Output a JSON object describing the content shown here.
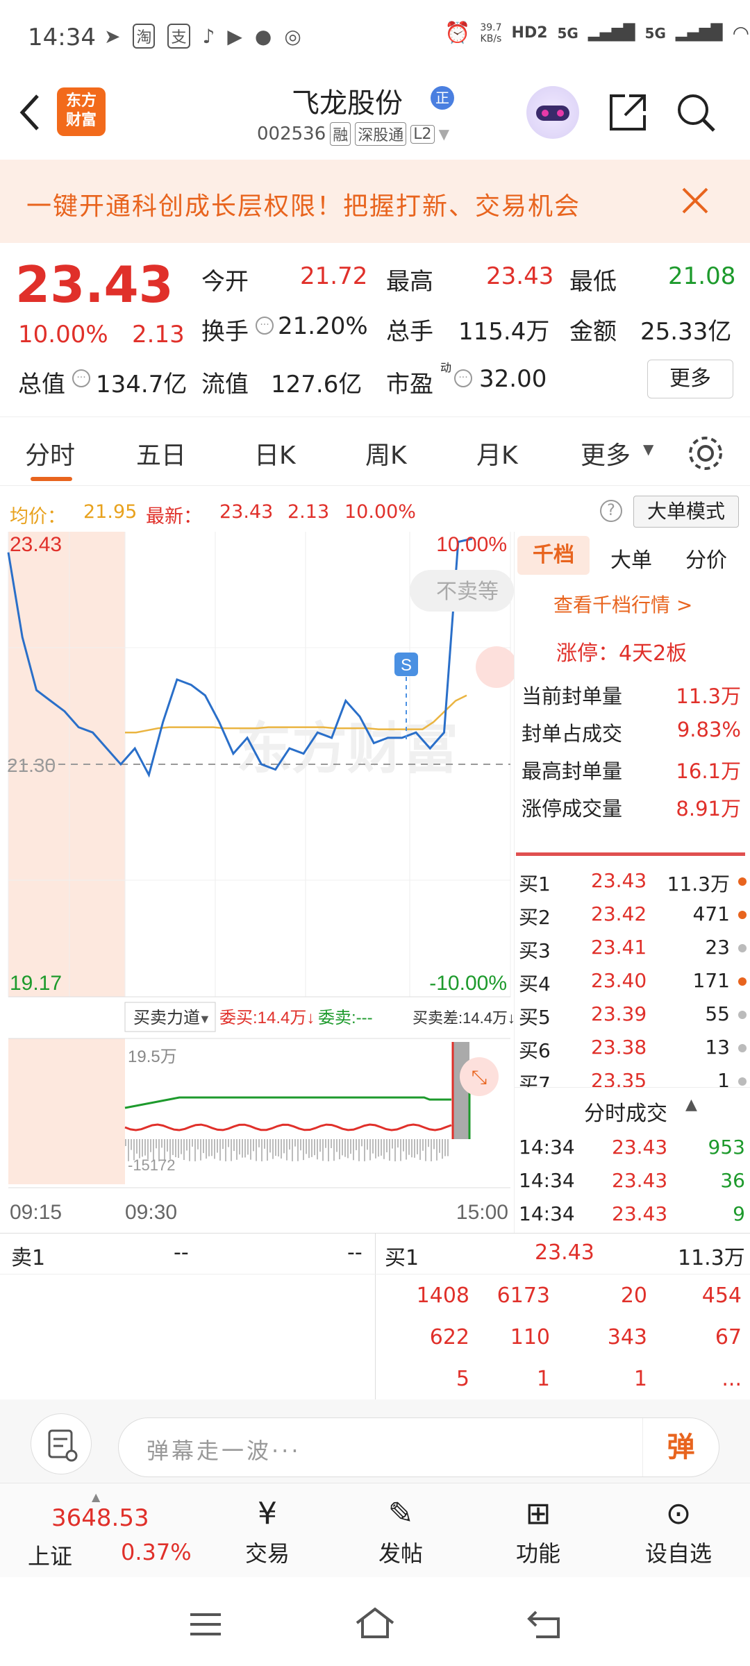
{
  "status_bar": {
    "time": "14:34",
    "net_speed": "39.7\nKB/s",
    "net_top": "39.7",
    "net_bottom": "KB/s",
    "hd": "HD2",
    "sig1": "5G",
    "sig2": "5G"
  },
  "header": {
    "app_logo_line1": "东方",
    "app_logo_line2": "财富",
    "stock_name": "飞龙股份",
    "tag_zheng": "正",
    "stock_code": "002536",
    "tag_rong": "融",
    "tag_sgt": "深股通",
    "tag_l2": "L2"
  },
  "banner": {
    "text": "一键开通科创成长层权限！把握打新、交易机会"
  },
  "quote": {
    "price": "23.43",
    "change_pct": "10.00%",
    "change": "2.13",
    "open_label": "今开",
    "open": "21.72",
    "high_label": "最高",
    "high": "23.43",
    "low_label": "最低",
    "low": "21.08",
    "turnover_label": "换手",
    "turnover": "21.20%",
    "volume_label": "总手",
    "volume": "115.4万",
    "amount_label": "金额",
    "amount": "25.33亿",
    "mktcap_label": "总值",
    "mktcap": "134.7亿",
    "float_label": "流值",
    "float": "127.6亿",
    "pe_label": "市盈",
    "pe_super": "动",
    "pe": "32.00",
    "more": "更多"
  },
  "tabs": [
    "分时",
    "五日",
    "日K",
    "周K",
    "月K",
    "更多"
  ],
  "info_line": {
    "avg_label": "均价：",
    "avg": "21.95",
    "latest_label": "最新：",
    "latest": "23.43",
    "chg": "2.13",
    "pct": "10.00%",
    "mode_button": "大单模式"
  },
  "chart": {
    "y_high": "23.43",
    "y_mid": "21.30",
    "y_low": "19.17",
    "pct_high": "10.00%",
    "pct_low": "-10.00%",
    "no_sell": "不卖等",
    "s_marker": "S",
    "watermark": "东方财富",
    "sub_selector": "买卖力道",
    "weibuy": "委买:14.4万↓",
    "weisell": "委卖:---",
    "diff": "买卖差:14.4万↓",
    "sub_top": "19.5万",
    "sub_bottom": "-15172",
    "t_start": "09:15",
    "t_open": "09:30",
    "t_end": "15:00"
  },
  "chart_data": {
    "type": "line",
    "title": "",
    "x_range": [
      "09:15",
      "15:00"
    ],
    "ylim": [
      19.17,
      23.43
    ],
    "prev_close": 21.3,
    "series": [
      {
        "name": "最新",
        "values": [
          23.3,
          22.5,
          22.0,
          21.9,
          21.8,
          21.65,
          21.6,
          21.45,
          21.3,
          21.45,
          21.2,
          21.7,
          22.1,
          22.05,
          21.95,
          21.7,
          21.4,
          21.55,
          21.3,
          21.25,
          21.45,
          21.4,
          21.6,
          21.55,
          21.9,
          21.75,
          21.5,
          21.55,
          21.55,
          21.6,
          21.45,
          21.6,
          23.4,
          23.43
        ]
      },
      {
        "name": "均价",
        "values": [
          21.6,
          21.6,
          21.62,
          21.64,
          21.65,
          21.65,
          21.65,
          21.65,
          21.65,
          21.64,
          21.64,
          21.64,
          21.64,
          21.65,
          21.65,
          21.65,
          21.65,
          21.65,
          21.65,
          21.64,
          21.64,
          21.64,
          21.64,
          21.63,
          21.63,
          21.63,
          21.63,
          21.63,
          21.7,
          21.8,
          21.9,
          21.95
        ]
      }
    ]
  },
  "right_panel": {
    "tabs": [
      "千档",
      "大单",
      "分价"
    ],
    "link": "查看千档行情 >",
    "limit_up": "涨停：4天2板",
    "stats": [
      [
        "当前封单量",
        "11.3万"
      ],
      [
        "封单占成交",
        "9.83%"
      ],
      [
        "最高封单量",
        "16.1万"
      ],
      [
        "涨停成交量",
        "8.91万"
      ]
    ],
    "bids": [
      [
        "买1",
        "23.43",
        "11.3万"
      ],
      [
        "买2",
        "23.42",
        "471"
      ],
      [
        "买3",
        "23.41",
        "23"
      ],
      [
        "买4",
        "23.40",
        "171"
      ],
      [
        "买5",
        "23.39",
        "55"
      ],
      [
        "买6",
        "23.38",
        "13"
      ],
      [
        "买7",
        "23.35",
        "1"
      ]
    ],
    "trades_title": "分时成交",
    "trades": [
      [
        "14:34",
        "23.43",
        "953"
      ],
      [
        "14:34",
        "23.43",
        "36"
      ],
      [
        "14:34",
        "23.43",
        "9"
      ]
    ]
  },
  "queue": {
    "sell_label": "卖1",
    "sell_price": "--",
    "sell_vol": "--",
    "buy_label": "买1",
    "buy_price": "23.43",
    "buy_vol": "11.3万",
    "rows": [
      [
        "1408",
        "6173",
        "20",
        "454"
      ],
      [
        "622",
        "110",
        "343",
        "67"
      ],
      [
        "5",
        "1",
        "1",
        "..."
      ]
    ]
  },
  "comment": {
    "placeholder": "弹幕走一波···",
    "btn": "弹"
  },
  "bottom_nav": {
    "index_value": "3648.53",
    "index_name": "上证",
    "index_pct": "0.37%",
    "items": [
      "交易",
      "发帖",
      "功能",
      "设自选"
    ]
  },
  "colors": {
    "red": "#e0302a",
    "green": "#1d9a2c",
    "orange": "#e8641e",
    "blue": "#2a6fc9"
  }
}
